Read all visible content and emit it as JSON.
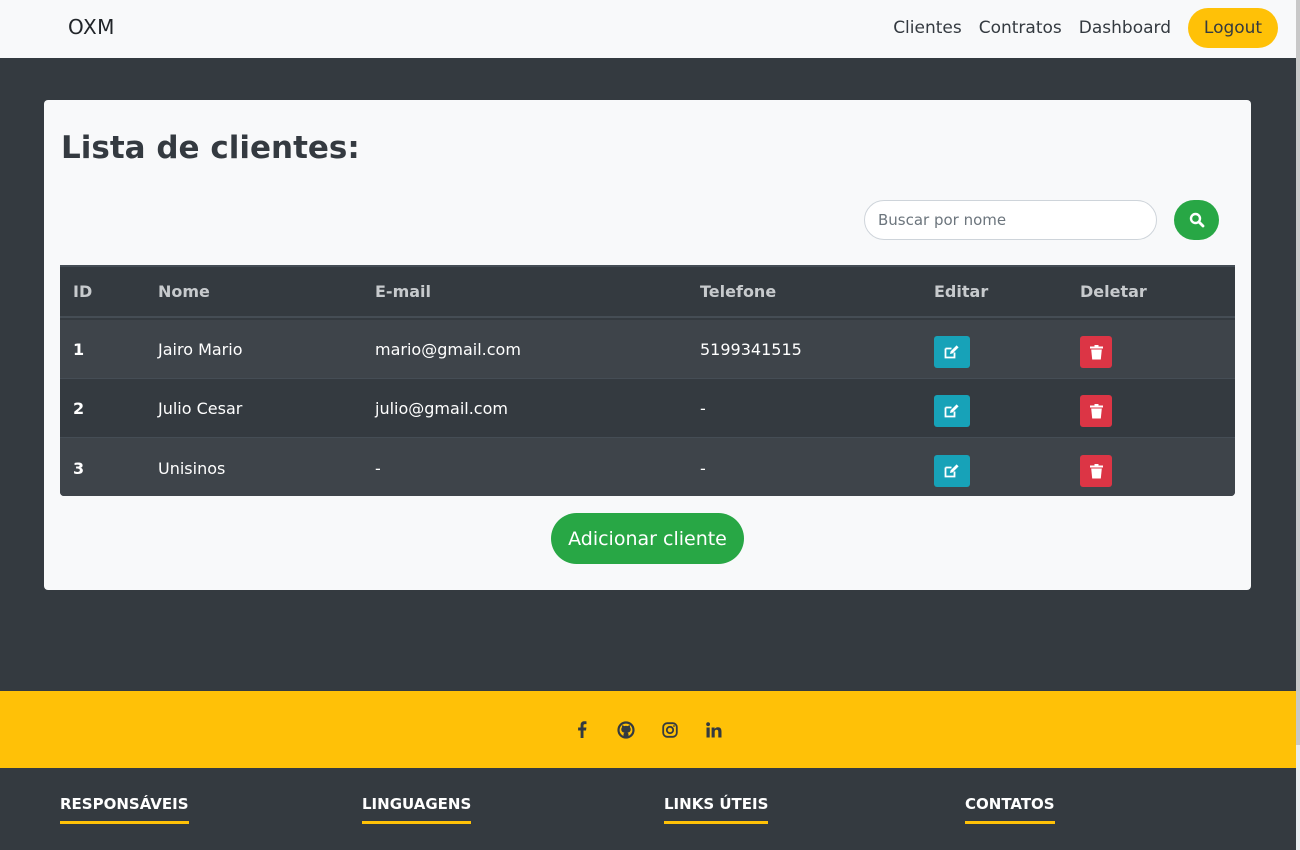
{
  "navbar": {
    "brand": "OXM",
    "links": [
      "Clientes",
      "Contratos",
      "Dashboard"
    ],
    "logout_label": "Logout"
  },
  "card": {
    "title": "Lista de clientes:",
    "search_placeholder": "Buscar por nome",
    "add_button_label": "Adicionar cliente"
  },
  "table": {
    "headers": [
      "ID",
      "Nome",
      "E-mail",
      "Telefone",
      "Editar",
      "Deletar"
    ],
    "rows": [
      {
        "id": "1",
        "nome": "Jairo Mario",
        "email": "mario@gmail.com",
        "telefone": "5199341515"
      },
      {
        "id": "2",
        "nome": "Julio Cesar",
        "email": "julio@gmail.com",
        "telefone": "-"
      },
      {
        "id": "3",
        "nome": "Unisinos",
        "email": "-",
        "telefone": "-"
      }
    ]
  },
  "footer": {
    "social_icons": [
      "facebook-icon",
      "github-icon",
      "instagram-icon",
      "linkedin-icon"
    ],
    "columns": [
      "RESPONSÁVEIS",
      "LINGUAGENS",
      "LINKS ÚTEIS",
      "CONTATOS"
    ]
  },
  "colors": {
    "primary_dark": "#343a40",
    "accent_yellow": "#ffc107",
    "success_green": "#28a745",
    "info_teal": "#17a2b8",
    "danger_red": "#dc3545"
  }
}
